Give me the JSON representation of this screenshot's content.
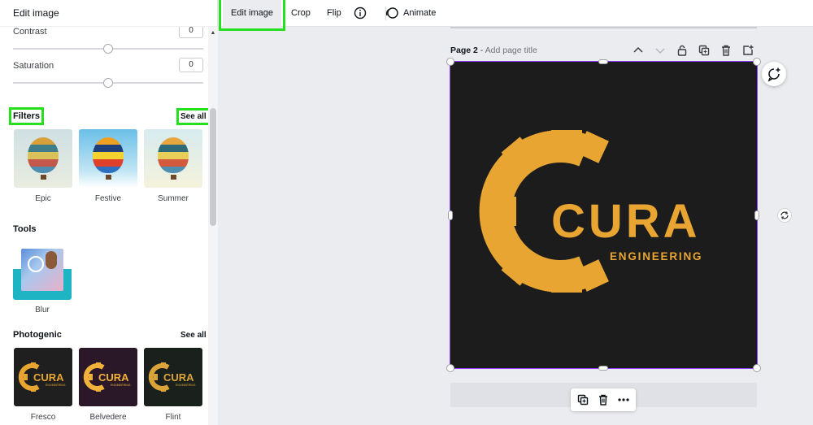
{
  "panel": {
    "title": "Edit image",
    "adjust": {
      "contrast": {
        "label": "Contrast",
        "value": "0"
      },
      "saturation": {
        "label": "Saturation",
        "value": "0"
      }
    },
    "filters": {
      "title": "Filters",
      "see_all": "See all",
      "items": [
        {
          "label": "Epic"
        },
        {
          "label": "Festive"
        },
        {
          "label": "Summer"
        }
      ]
    },
    "tools": {
      "title": "Tools",
      "items": [
        {
          "label": "Blur"
        }
      ]
    },
    "photogenic": {
      "title": "Photogenic",
      "see_all": "See all",
      "items": [
        {
          "label": "Fresco"
        },
        {
          "label": "Belvedere"
        },
        {
          "label": "Flint"
        }
      ]
    }
  },
  "toolbar": {
    "edit_image": "Edit image",
    "crop": "Crop",
    "flip": "Flip",
    "animate": "Animate"
  },
  "page": {
    "label": "Page 2",
    "separator": " - ",
    "title_placeholder": "Add page title"
  },
  "design": {
    "logo_word": "CURA",
    "logo_sub": "ENGINEERING",
    "background": "#1c1c1c",
    "accent": "#e9a532"
  },
  "colors": {
    "highlight": "#26e020",
    "selection": "#8b3dff"
  }
}
